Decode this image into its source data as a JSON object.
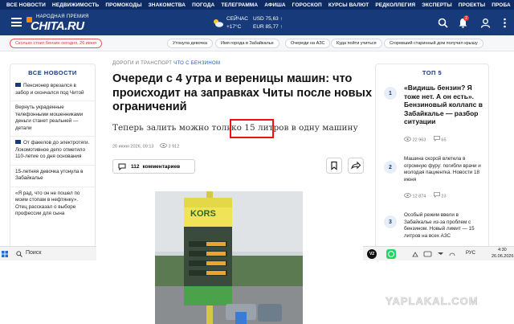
{
  "topnav": [
    "ВСЕ НОВОСТИ",
    "НЕДВИЖИМОСТЬ",
    "ПРОМОКОДЫ",
    "ЗНАКОМСТВА",
    "ПОГОДА",
    "ТЕЛЕГРАММА",
    "АФИША",
    "ГОРОСКОП",
    "КУРСЫ ВАЛЮТ",
    "РЕДКОЛЛЕГИЯ",
    "ЭКСПЕРТЫ",
    "ПРОЕКТЫ",
    "ПРОБА"
  ],
  "header": {
    "logo_small": "НАРОДНАЯ ПРЕМИЯ",
    "logo_big": "CHITA.RU",
    "weather_now": "СЕЙЧАС",
    "weather_temp": "+17°C",
    "usd": "USD 75,63 ↑",
    "eur": "EUR 85,77 ↑",
    "notif_count": "2"
  },
  "subbar": {
    "alert": "Сколько стоит бензин сегодня, 26 июня",
    "tags": [
      "Утонула девочка",
      "Имя города в Забайкалье",
      "Очереди на АЗС",
      "Куда пойти учиться",
      "Сгоревший старинный дом получил крышу"
    ]
  },
  "sidebar": {
    "title": "ВСЕ НОВОСТИ",
    "items": [
      "Пенсионер врезался в забор и скончался под Читой",
      "Вернуть украденные телефонными мошенниками деньги станет реальней — детали",
      "От факелов до электротяги. Локомотивное депо отметило 110-летие со дня основания",
      "15-летняя девочка утонула в Забайкалье",
      "«Я рад, что он не пошел по моим стопам в нефтянку». Отец рассказал о выборе профессии для сына"
    ]
  },
  "article": {
    "category": "ДОРОГИ И ТРАНСПОРТ",
    "category_tag": "ЧТО С БЕНЗИНОМ",
    "title": "Очереди с 4 утра и вереницы машин: что происходит на заправках Читы после новых ограничений",
    "lead_before": "Теперь залить можно только ",
    "lead_highlight": "15 литров",
    "lead_after": " в одну машину",
    "date": "26 июня 2026, 09:13",
    "views": "3 912",
    "comments_count": "112",
    "comments_label": "комментариев",
    "photo_sign": "KORS"
  },
  "top5": {
    "title": "ТОП 5",
    "items": [
      {
        "num": "1",
        "text": "«Видишь бензин? Я тоже нет. А он есть». Бензиновый коллапс в Забайкалье — разбор ситуации",
        "views": "22 963",
        "comments": "65"
      },
      {
        "num": "2",
        "text": "Машина скорой влетела в огромную фуру: погибли врачи и молодая пациентка. Новости 18 июня",
        "views": "12 874",
        "comments": "23"
      },
      {
        "num": "3",
        "text": "Особый режим ввели в Забайкалье из-за проблем с бензином. Новый лимит — 15 литров на всех АЗС"
      }
    ]
  },
  "taskbar": {
    "search_placeholder": "Поиск",
    "lang": "РУС",
    "time": "4:30",
    "date": "26.06.2026"
  },
  "watermark": "YAPLAKAL.COM"
}
